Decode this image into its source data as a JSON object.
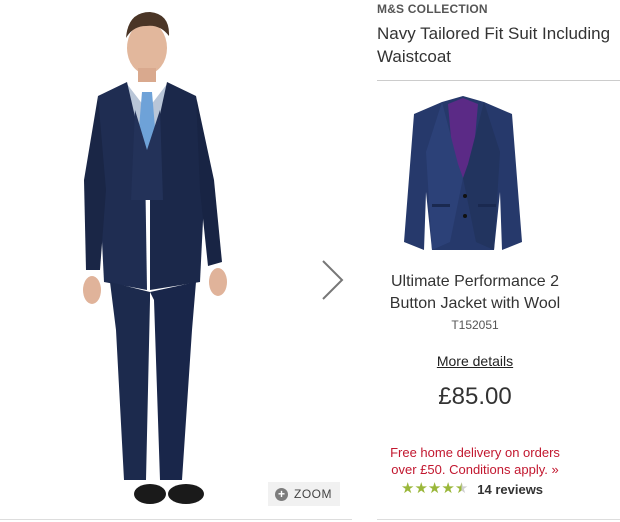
{
  "brand": "M&S COLLECTION",
  "title": "Navy Tailored Fit Suit Including Waistcoat",
  "zoom_label": "ZOOM",
  "product": {
    "name": "Ultimate Performance 2 Button Jacket with Wool",
    "code": "T152051",
    "more_details": "More details",
    "price": "£85.00"
  },
  "delivery_text": "Free home delivery on orders over £50. Conditions apply. »",
  "rating": {
    "value": 4.5,
    "max": 5,
    "reviews": "14 reviews"
  },
  "colors": {
    "suit": "#1c2a4d",
    "lining": "#5b2a86",
    "delivery": "#c2172f",
    "star": "#9ab73a"
  }
}
